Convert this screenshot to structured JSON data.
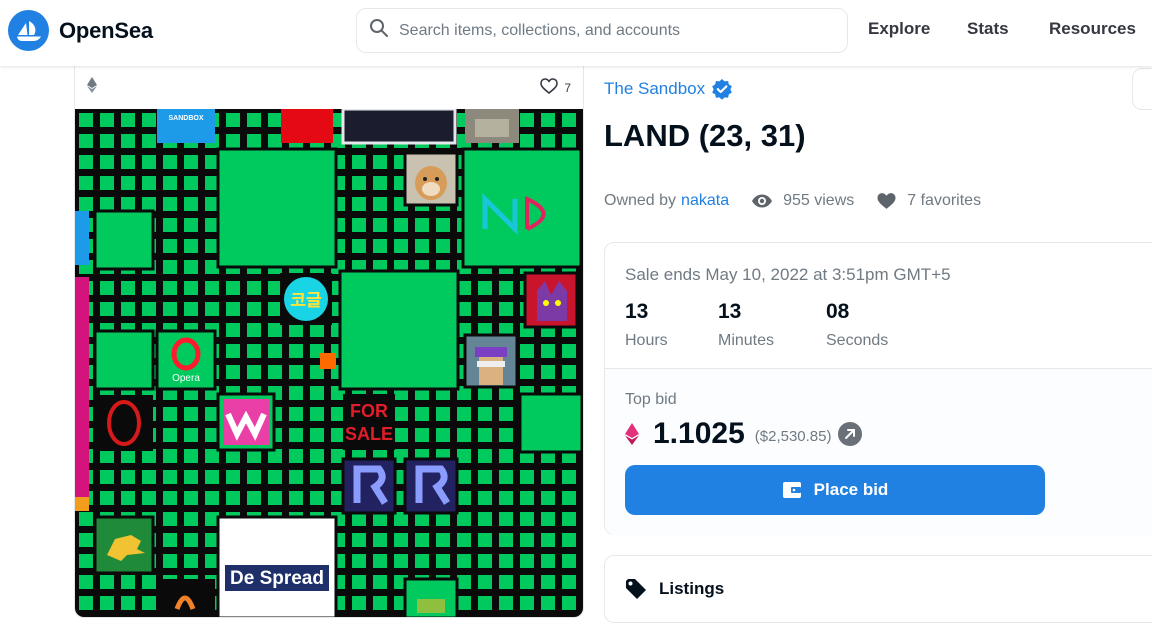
{
  "header": {
    "logo_text": "OpenSea",
    "search_placeholder": "Search items, collections, and accounts",
    "nav": [
      "Explore",
      "Stats",
      "Resources"
    ]
  },
  "card": {
    "favorite_count": "7",
    "map_labels": {
      "sandbox": "SANDBOX",
      "korean": "코글",
      "opera": "Opera",
      "for": "FOR",
      "sale": "SALE",
      "despread": "De Spread"
    }
  },
  "asset": {
    "collection": "The Sandbox",
    "title": "LAND (23, 31)",
    "owned_by_label": "Owned by",
    "owner": "nakata",
    "views": "955 views",
    "favorites": "7 favorites"
  },
  "sale": {
    "ends_text": "Sale ends May 10, 2022 at 3:51pm GMT+5",
    "countdown": [
      {
        "value": "13",
        "label": "Hours"
      },
      {
        "value": "13",
        "label": "Minutes"
      },
      {
        "value": "08",
        "label": "Seconds"
      }
    ]
  },
  "bid": {
    "label": "Top bid",
    "amount": "1.1025",
    "usd": "($2,530.85)",
    "button": "Place bid"
  },
  "listings": {
    "label": "Listings"
  },
  "colors": {
    "accent": "#2081e2",
    "land_green": "#00c95d",
    "grid_dark": "#0a0a0a",
    "eth_pink": "#e2307a"
  },
  "icons": [
    "opensea-logo-icon",
    "search-icon",
    "ethereum-icon",
    "heart-icon",
    "verified-badge-icon",
    "eye-icon",
    "external-link-icon",
    "wallet-icon",
    "tag-icon"
  ]
}
